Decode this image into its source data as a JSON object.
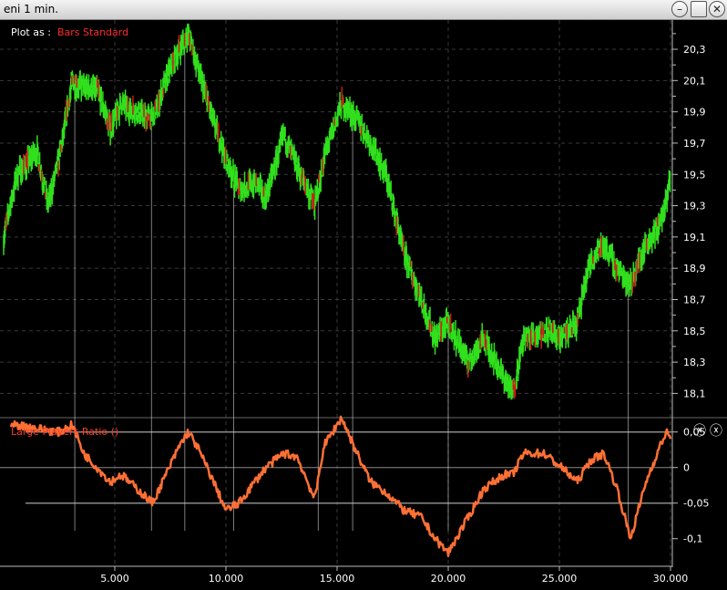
{
  "window": {
    "title": "eni  1 min.",
    "buttons": {
      "minimize": "–",
      "maximize": "",
      "close": "✕"
    }
  },
  "toolbar": {
    "plot_as_label": "Plot as :",
    "plot_as_value": "Bars Standard"
  },
  "indicator": {
    "label": "Large Players Ratio ()",
    "close_labels": [
      "ⓧ",
      "ⓧ"
    ]
  },
  "colors": {
    "background": "#000000",
    "bar_up": "#30e01c",
    "bar_down": "#d01818",
    "indicator_line": "#ff7034",
    "reference_line": "#8a8a8a",
    "grid": "#3a3a3a"
  },
  "chart_data": [
    {
      "type": "line",
      "subtype": "price bars",
      "x_ticks": [
        "5.000",
        "10.000",
        "15.000",
        "20.000",
        "25.000",
        "30.000"
      ],
      "y_ticks": [
        "20,3",
        "20,1",
        "19,9",
        "19,7",
        "19,5",
        "19,3",
        "19,1",
        "18,9",
        "18,7",
        "18,5",
        "18,3",
        "18,1"
      ],
      "xlim": [
        0,
        30000
      ],
      "ylim": [
        17.98,
        20.44
      ],
      "x": [
        0,
        600,
        1500,
        2000,
        2500,
        3100,
        3600,
        4200,
        4800,
        5300,
        6000,
        6700,
        7300,
        7900,
        8300,
        8700,
        9300,
        10000,
        10600,
        11300,
        11800,
        12600,
        13200,
        14000,
        14400,
        15200,
        15900,
        16500,
        17200,
        18000,
        18800,
        19400,
        20000,
        20900,
        21600,
        22500,
        22900,
        23400,
        24300,
        25100,
        25800,
        26400,
        27000,
        27600,
        28200,
        28900,
        29400,
        29800,
        30000
      ],
      "y": [
        19.1,
        19.5,
        19.65,
        19.3,
        19.6,
        20.1,
        20.05,
        20.05,
        19.8,
        19.95,
        19.9,
        19.85,
        20.1,
        20.3,
        20.4,
        20.2,
        19.9,
        19.6,
        19.4,
        19.45,
        19.35,
        19.75,
        19.55,
        19.3,
        19.6,
        19.95,
        19.85,
        19.7,
        19.5,
        19.0,
        18.7,
        18.45,
        18.55,
        18.3,
        18.45,
        18.2,
        18.1,
        18.45,
        18.5,
        18.45,
        18.55,
        18.95,
        19.05,
        18.9,
        18.8,
        19.05,
        19.15,
        19.3,
        19.5
      ],
      "series": [
        {
          "name": "Bars Standard"
        }
      ]
    },
    {
      "type": "line",
      "y_ticks": [
        "0,05",
        "0",
        "-0,05",
        "-0,1"
      ],
      "ylim": [
        -0.135,
        0.065
      ],
      "reference_lines": [
        0.05,
        0,
        -0.05
      ],
      "x": [
        0,
        600,
        1500,
        2500,
        3100,
        3600,
        4200,
        4800,
        5300,
        6000,
        6700,
        7300,
        7900,
        8300,
        8700,
        9300,
        10000,
        10600,
        11300,
        11800,
        12600,
        13200,
        14000,
        14400,
        15200,
        15900,
        16500,
        17200,
        18000,
        18800,
        19400,
        20000,
        20900,
        21600,
        22500,
        22900,
        23400,
        24300,
        25100,
        25800,
        26400,
        27000,
        27600,
        28200,
        28900,
        29400,
        29800,
        30000
      ],
      "y": [
        0.06,
        0.06,
        0.055,
        0.05,
        0.06,
        0.02,
        0.0,
        -0.02,
        -0.01,
        -0.03,
        -0.05,
        -0.01,
        0.03,
        0.05,
        0.03,
        -0.01,
        -0.06,
        -0.05,
        -0.02,
        0.0,
        0.02,
        0.015,
        -0.045,
        0.03,
        0.07,
        0.02,
        -0.02,
        -0.035,
        -0.06,
        -0.07,
        -0.1,
        -0.12,
        -0.07,
        -0.03,
        -0.01,
        -0.01,
        0.02,
        0.02,
        0.0,
        -0.02,
        0.01,
        0.02,
        -0.03,
        -0.1,
        -0.02,
        0.02,
        0.05,
        0.04
      ],
      "series": [
        {
          "name": "Large Players Ratio ()"
        }
      ]
    }
  ]
}
